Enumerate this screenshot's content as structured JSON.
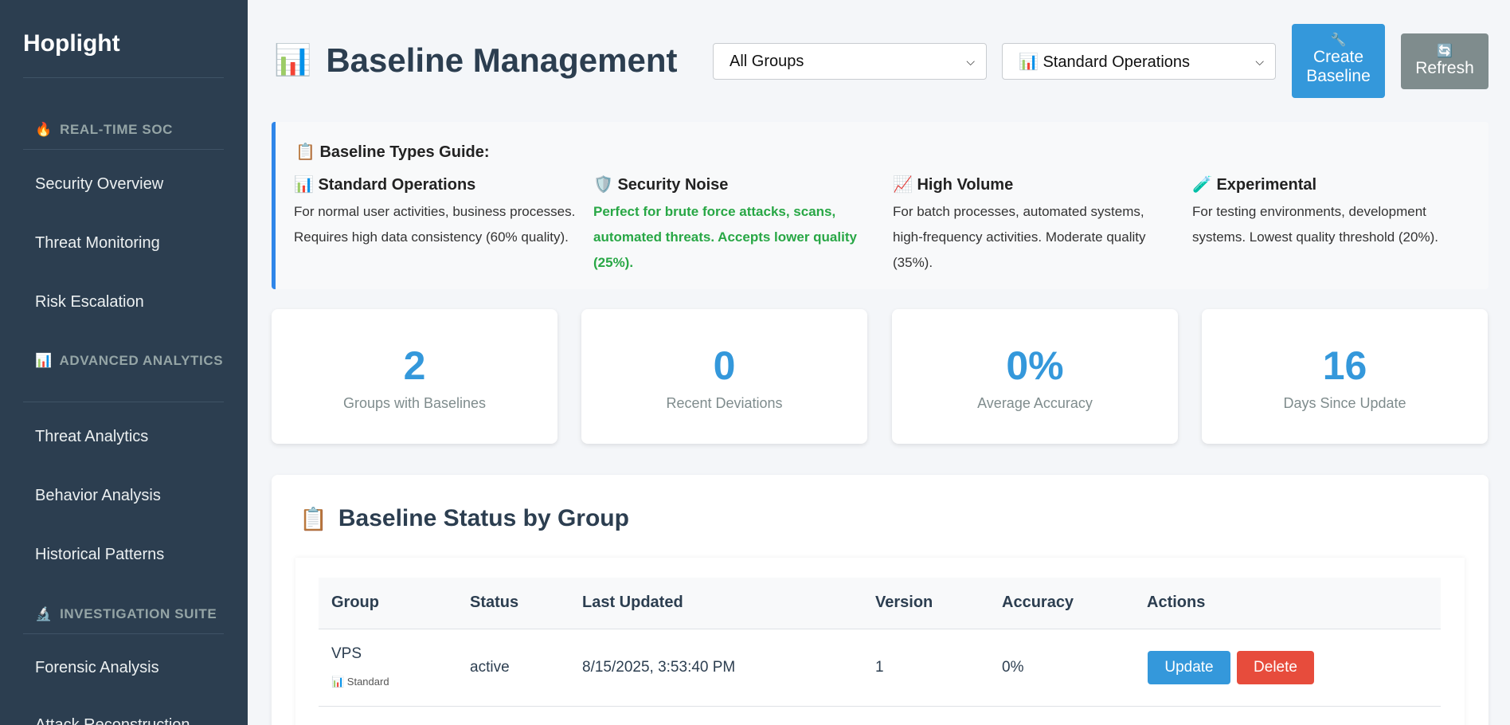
{
  "sidebar": {
    "brand": "Hoplight",
    "sections": [
      {
        "icon": "🔥",
        "label": "REAL-TIME SOC"
      },
      {
        "icon": "📊",
        "label": "ADVANCED ANALYTICS"
      },
      {
        "icon": "🔬",
        "label": "INVESTIGATION SUITE"
      }
    ],
    "items": [
      {
        "label": "Security Overview"
      },
      {
        "label": "Threat Monitoring"
      },
      {
        "label": "Risk Escalation"
      },
      {
        "label": "Threat Analytics"
      },
      {
        "label": "Behavior Analysis"
      },
      {
        "label": "Historical Patterns"
      },
      {
        "label": "Forensic Analysis"
      },
      {
        "label": "Attack Reconstruction"
      }
    ]
  },
  "header": {
    "icon": "📊",
    "title": "Baseline Management",
    "group_select": "All Groups",
    "type_select": "📊 Standard Operations",
    "create_icon": "🔧",
    "create_label": "Create Baseline",
    "refresh_icon": "🔄",
    "refresh_label": "Refresh"
  },
  "guide": {
    "icon": "📋",
    "title": "Baseline Types Guide:",
    "types": [
      {
        "icon": "📊",
        "name": "Standard Operations",
        "desc": "For normal user activities, business processes. Requires high data consistency (60% quality)."
      },
      {
        "icon": "🛡️",
        "name": "Security Noise",
        "desc": "Perfect for brute force attacks, scans, automated threats. Accepts lower quality (25%)."
      },
      {
        "icon": "📈",
        "name": "High Volume",
        "desc": "For batch processes, automated systems, high-frequency activities. Moderate quality (35%)."
      },
      {
        "icon": "🧪",
        "name": "Experimental",
        "desc": "For testing environments, development systems. Lowest quality threshold (20%)."
      }
    ]
  },
  "stats": [
    {
      "value": "2",
      "label": "Groups with Baselines"
    },
    {
      "value": "0",
      "label": "Recent Deviations"
    },
    {
      "value": "0%",
      "label": "Average Accuracy"
    },
    {
      "value": "16",
      "label": "Days Since Update"
    }
  ],
  "status_panel": {
    "icon": "📋",
    "title": "Baseline Status by Group",
    "columns": [
      "Group",
      "Status",
      "Last Updated",
      "Version",
      "Accuracy",
      "Actions"
    ],
    "rows": [
      {
        "group": "VPS",
        "type_badge": "📊 Standard",
        "status": "active",
        "last_updated": "8/15/2025, 3:53:40 PM",
        "version": "1",
        "accuracy": "0%",
        "update_label": "Update",
        "delete_label": "Delete"
      }
    ]
  },
  "colors": {
    "sidebar_bg": "#2c3e50",
    "accent": "#3498db",
    "danger": "#e74c3c",
    "success": "#28a745",
    "muted_button": "#7f8c8d",
    "guide_border": "#2f86e9"
  }
}
